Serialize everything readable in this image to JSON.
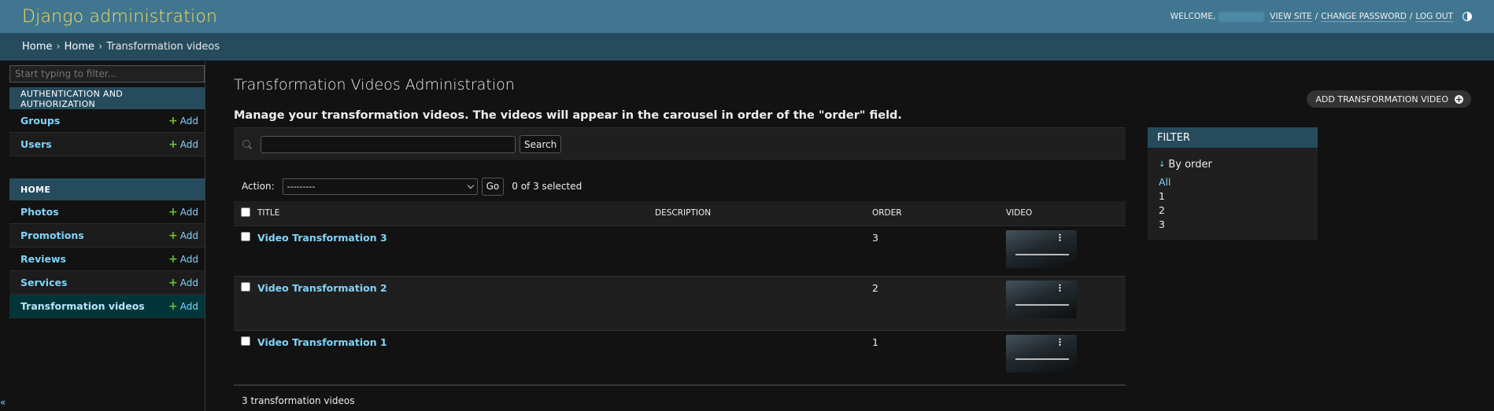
{
  "header": {
    "site_name": "Django administration",
    "welcome": "WELCOME,",
    "view_site": "VIEW SITE",
    "change_password": "CHANGE PASSWORD",
    "log_out": "LOG OUT",
    "sep": "/"
  },
  "breadcrumbs": [
    "Home",
    "Home",
    "Transformation videos"
  ],
  "sidebar": {
    "filter_placeholder": "Start typing to filter...",
    "modules": [
      {
        "caption": "Authentication and Authorization",
        "models": [
          {
            "name": "Groups",
            "add": "Add"
          },
          {
            "name": "Users",
            "add": "Add"
          }
        ]
      },
      {
        "caption": "Home",
        "models": [
          {
            "name": "Photos",
            "add": "Add"
          },
          {
            "name": "Promotions",
            "add": "Add"
          },
          {
            "name": "Reviews",
            "add": "Add"
          },
          {
            "name": "Services",
            "add": "Add"
          },
          {
            "name": "Transformation videos",
            "add": "Add"
          }
        ]
      }
    ],
    "collapse": "«"
  },
  "content": {
    "title": "Transformation Videos Administration",
    "subtitle": "Manage your transformation videos. The videos will appear in the carousel in order of the \"order\" field.",
    "add_button": "ADD TRANSFORMATION VIDEO",
    "search_button": "Search",
    "action_label": "Action:",
    "action_selected": "---------",
    "go_button": "Go",
    "selected_count": "0 of 3 selected",
    "columns": [
      "Title",
      "Description",
      "Order",
      "Video"
    ],
    "rows": [
      {
        "title": "Video Transformation 3",
        "description": "",
        "order": "3"
      },
      {
        "title": "Video Transformation 2",
        "description": "",
        "order": "2"
      },
      {
        "title": "Video Transformation 1",
        "description": "",
        "order": "1"
      }
    ],
    "result_count": "3 transformation videos"
  },
  "filter": {
    "heading": "Filter",
    "by_order": "By order",
    "options": [
      "All",
      "1",
      "2",
      "3"
    ]
  },
  "colors": {
    "header_bg": "#417690",
    "breadcrumbs_bg": "#264b5d",
    "link": "#81d4fa",
    "site_name": "#f5dd5d",
    "add_plus": "#70bf2b"
  },
  "icons": [
    "theme-toggle-icon",
    "search-icon",
    "plus-icon",
    "chevron-down-icon",
    "arrow-down-icon"
  ]
}
